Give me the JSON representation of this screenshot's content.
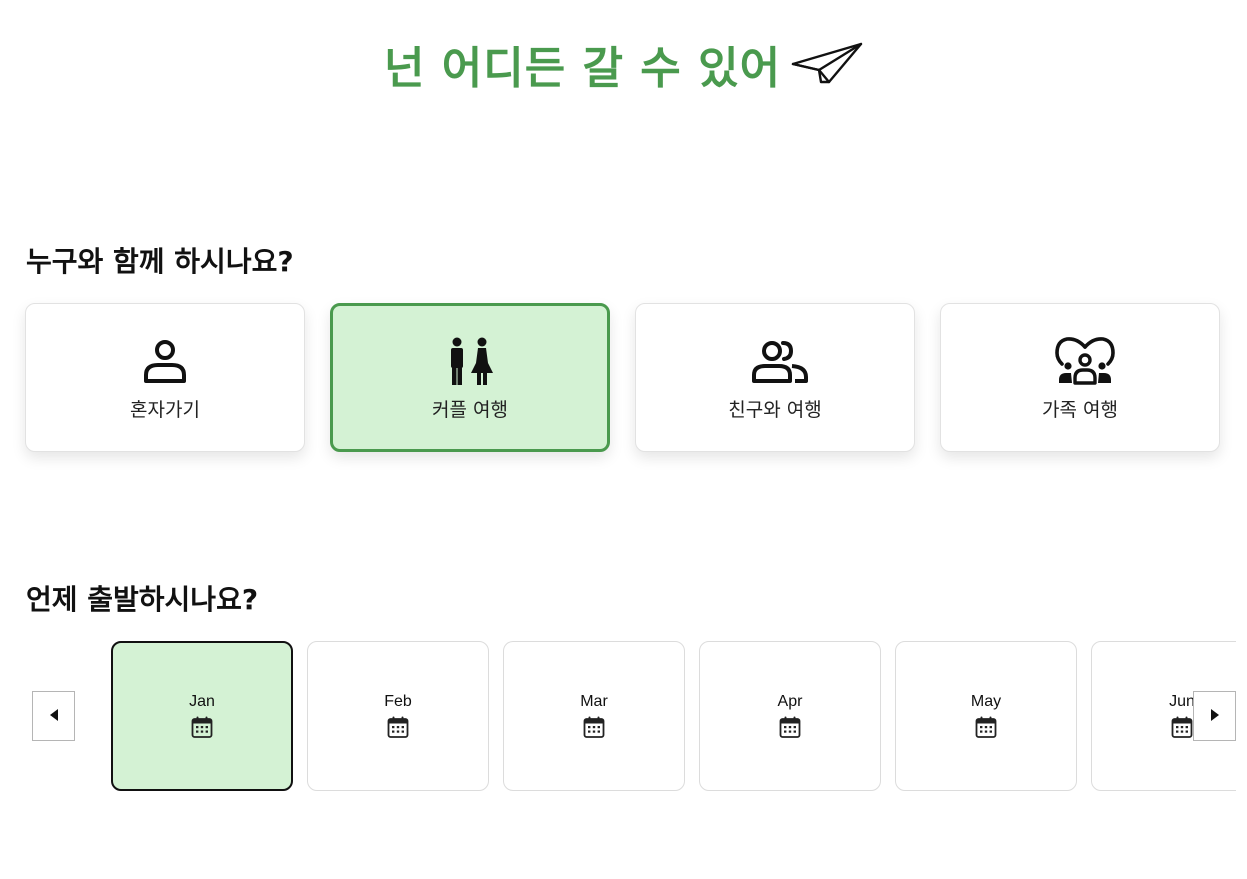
{
  "colors": {
    "accent": "#4a9a4e",
    "selected_bg": "#d4f2d4",
    "text": "#111111",
    "card_border": "#e2e2e2"
  },
  "header": {
    "title": "넌 어디든 갈 수 있어",
    "icon": "paper-plane-icon"
  },
  "companion_section": {
    "title": "누구와 함께 하시나요?",
    "options": [
      {
        "label": "혼자가기",
        "icon": "single-person-icon",
        "selected": false
      },
      {
        "label": "커플 여행",
        "icon": "couple-icon",
        "selected": true
      },
      {
        "label": "친구와 여행",
        "icon": "friends-icon",
        "selected": false
      },
      {
        "label": "가족 여행",
        "icon": "family-icon",
        "selected": false
      }
    ]
  },
  "month_section": {
    "title": "언제 출발하시나요?",
    "months": [
      {
        "label": "Jan",
        "icon": "calendar-icon",
        "selected": true
      },
      {
        "label": "Feb",
        "icon": "calendar-icon",
        "selected": false
      },
      {
        "label": "Mar",
        "icon": "calendar-icon",
        "selected": false
      },
      {
        "label": "Apr",
        "icon": "calendar-icon",
        "selected": false
      },
      {
        "label": "May",
        "icon": "calendar-icon",
        "selected": false
      },
      {
        "label": "Jun",
        "icon": "calendar-icon",
        "selected": false
      }
    ],
    "prev_icon": "caret-left-icon",
    "next_icon": "caret-right-icon"
  }
}
